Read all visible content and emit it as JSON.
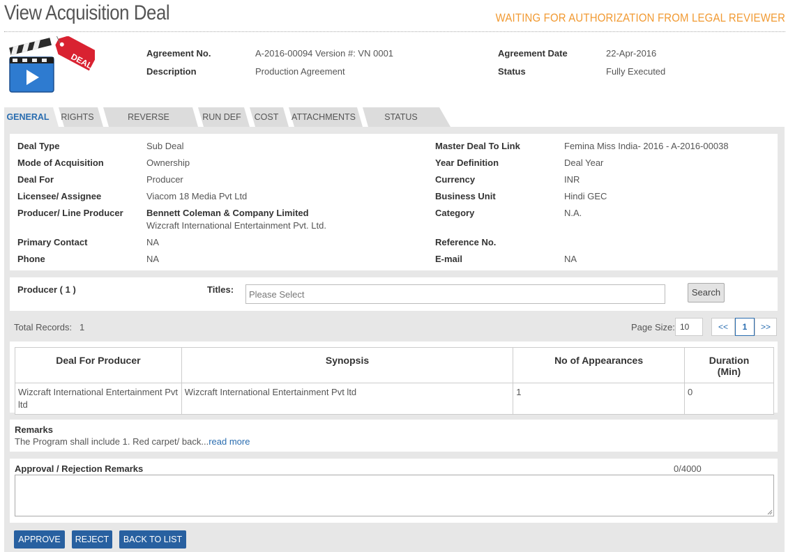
{
  "page": {
    "title": "View Acquisition Deal",
    "status_banner": "WAITING FOR AUTHORIZATION FROM LEGAL REVIEWER"
  },
  "logo": {
    "tag_text": "DEAL",
    "icon": "clapperboard-play-icon"
  },
  "header": {
    "agreement_no_label": "Agreement No.",
    "agreement_no_value": "A-2016-00094 Version #: VN 0001",
    "description_label": "Description",
    "description_value": "Production Agreement",
    "agreement_date_label": "Agreement Date",
    "agreement_date_value": "22-Apr-2016",
    "status_label": "Status",
    "status_value": "Fully Executed"
  },
  "tabs": [
    {
      "label": "GENERAL",
      "active": true
    },
    {
      "label": "RIGHTS"
    },
    {
      "label": "REVERSE HOLDBACK"
    },
    {
      "label": "RUN DEF"
    },
    {
      "label": "COST"
    },
    {
      "label": "ATTACHMENTS"
    },
    {
      "label": "STATUS HISTORY"
    }
  ],
  "general": {
    "deal_type_label": "Deal Type",
    "deal_type_value": "Sub Deal",
    "mode_label": "Mode of Acquisition",
    "mode_value": "Ownership",
    "deal_for_label": "Deal For",
    "deal_for_value": "Producer",
    "licensee_label": "Licensee/ Assignee",
    "licensee_value": "Viacom 18 Media Pvt Ltd",
    "producer_label": "Producer/ Line Producer",
    "producer_value_1": "Bennett Coleman & Company Limited",
    "producer_value_2": "Wizcraft International Entertainment Pvt. Ltd.",
    "primary_contact_label": "Primary Contact",
    "primary_contact_value": "NA",
    "phone_label": "Phone",
    "phone_value": "NA",
    "master_deal_label": "Master Deal To Link",
    "master_deal_value": "Femina Miss India- 2016 - A-2016-00038",
    "year_def_label": "Year Definition",
    "year_def_value": "Deal Year",
    "currency_label": "Currency",
    "currency_value": "INR",
    "business_unit_label": "Business Unit",
    "business_unit_value": "Hindi GEC",
    "category_label": "Category",
    "category_value": "N.A.",
    "reference_label": "Reference No.",
    "reference_value": "",
    "email_label": "E-mail",
    "email_value": "NA"
  },
  "producer_filter": {
    "heading": "Producer ( 1 )",
    "titles_label": "Titles:",
    "titles_placeholder": "Please Select",
    "search_label": "Search"
  },
  "records": {
    "total_label": "Total Records:",
    "total_value": "1",
    "page_size_label": "Page Size:",
    "page_size_value": "10",
    "prev": "<<",
    "current_page": "1",
    "next": ">>"
  },
  "table": {
    "columns": [
      "Deal For Producer",
      "Synopsis",
      "No of Appearances",
      "Duration (Min)"
    ],
    "rows": [
      [
        "Wizcraft International Entertainment Pvt ltd",
        "Wizcraft International Entertainment Pvt ltd",
        "1",
        "0"
      ]
    ]
  },
  "remarks": {
    "label": "Remarks",
    "text": "The Program shall include 1. Red carpet/ back...",
    "read_more": "read more"
  },
  "approval": {
    "label": "Approval / Rejection Remarks",
    "counter": "0/4000",
    "value": ""
  },
  "actions": {
    "approve": "APPROVE",
    "reject": "REJECT",
    "back": "BACK TO LIST"
  },
  "colors": {
    "accent": "#2860a0",
    "banner": "#f19a33",
    "tag_red": "#d92231"
  }
}
